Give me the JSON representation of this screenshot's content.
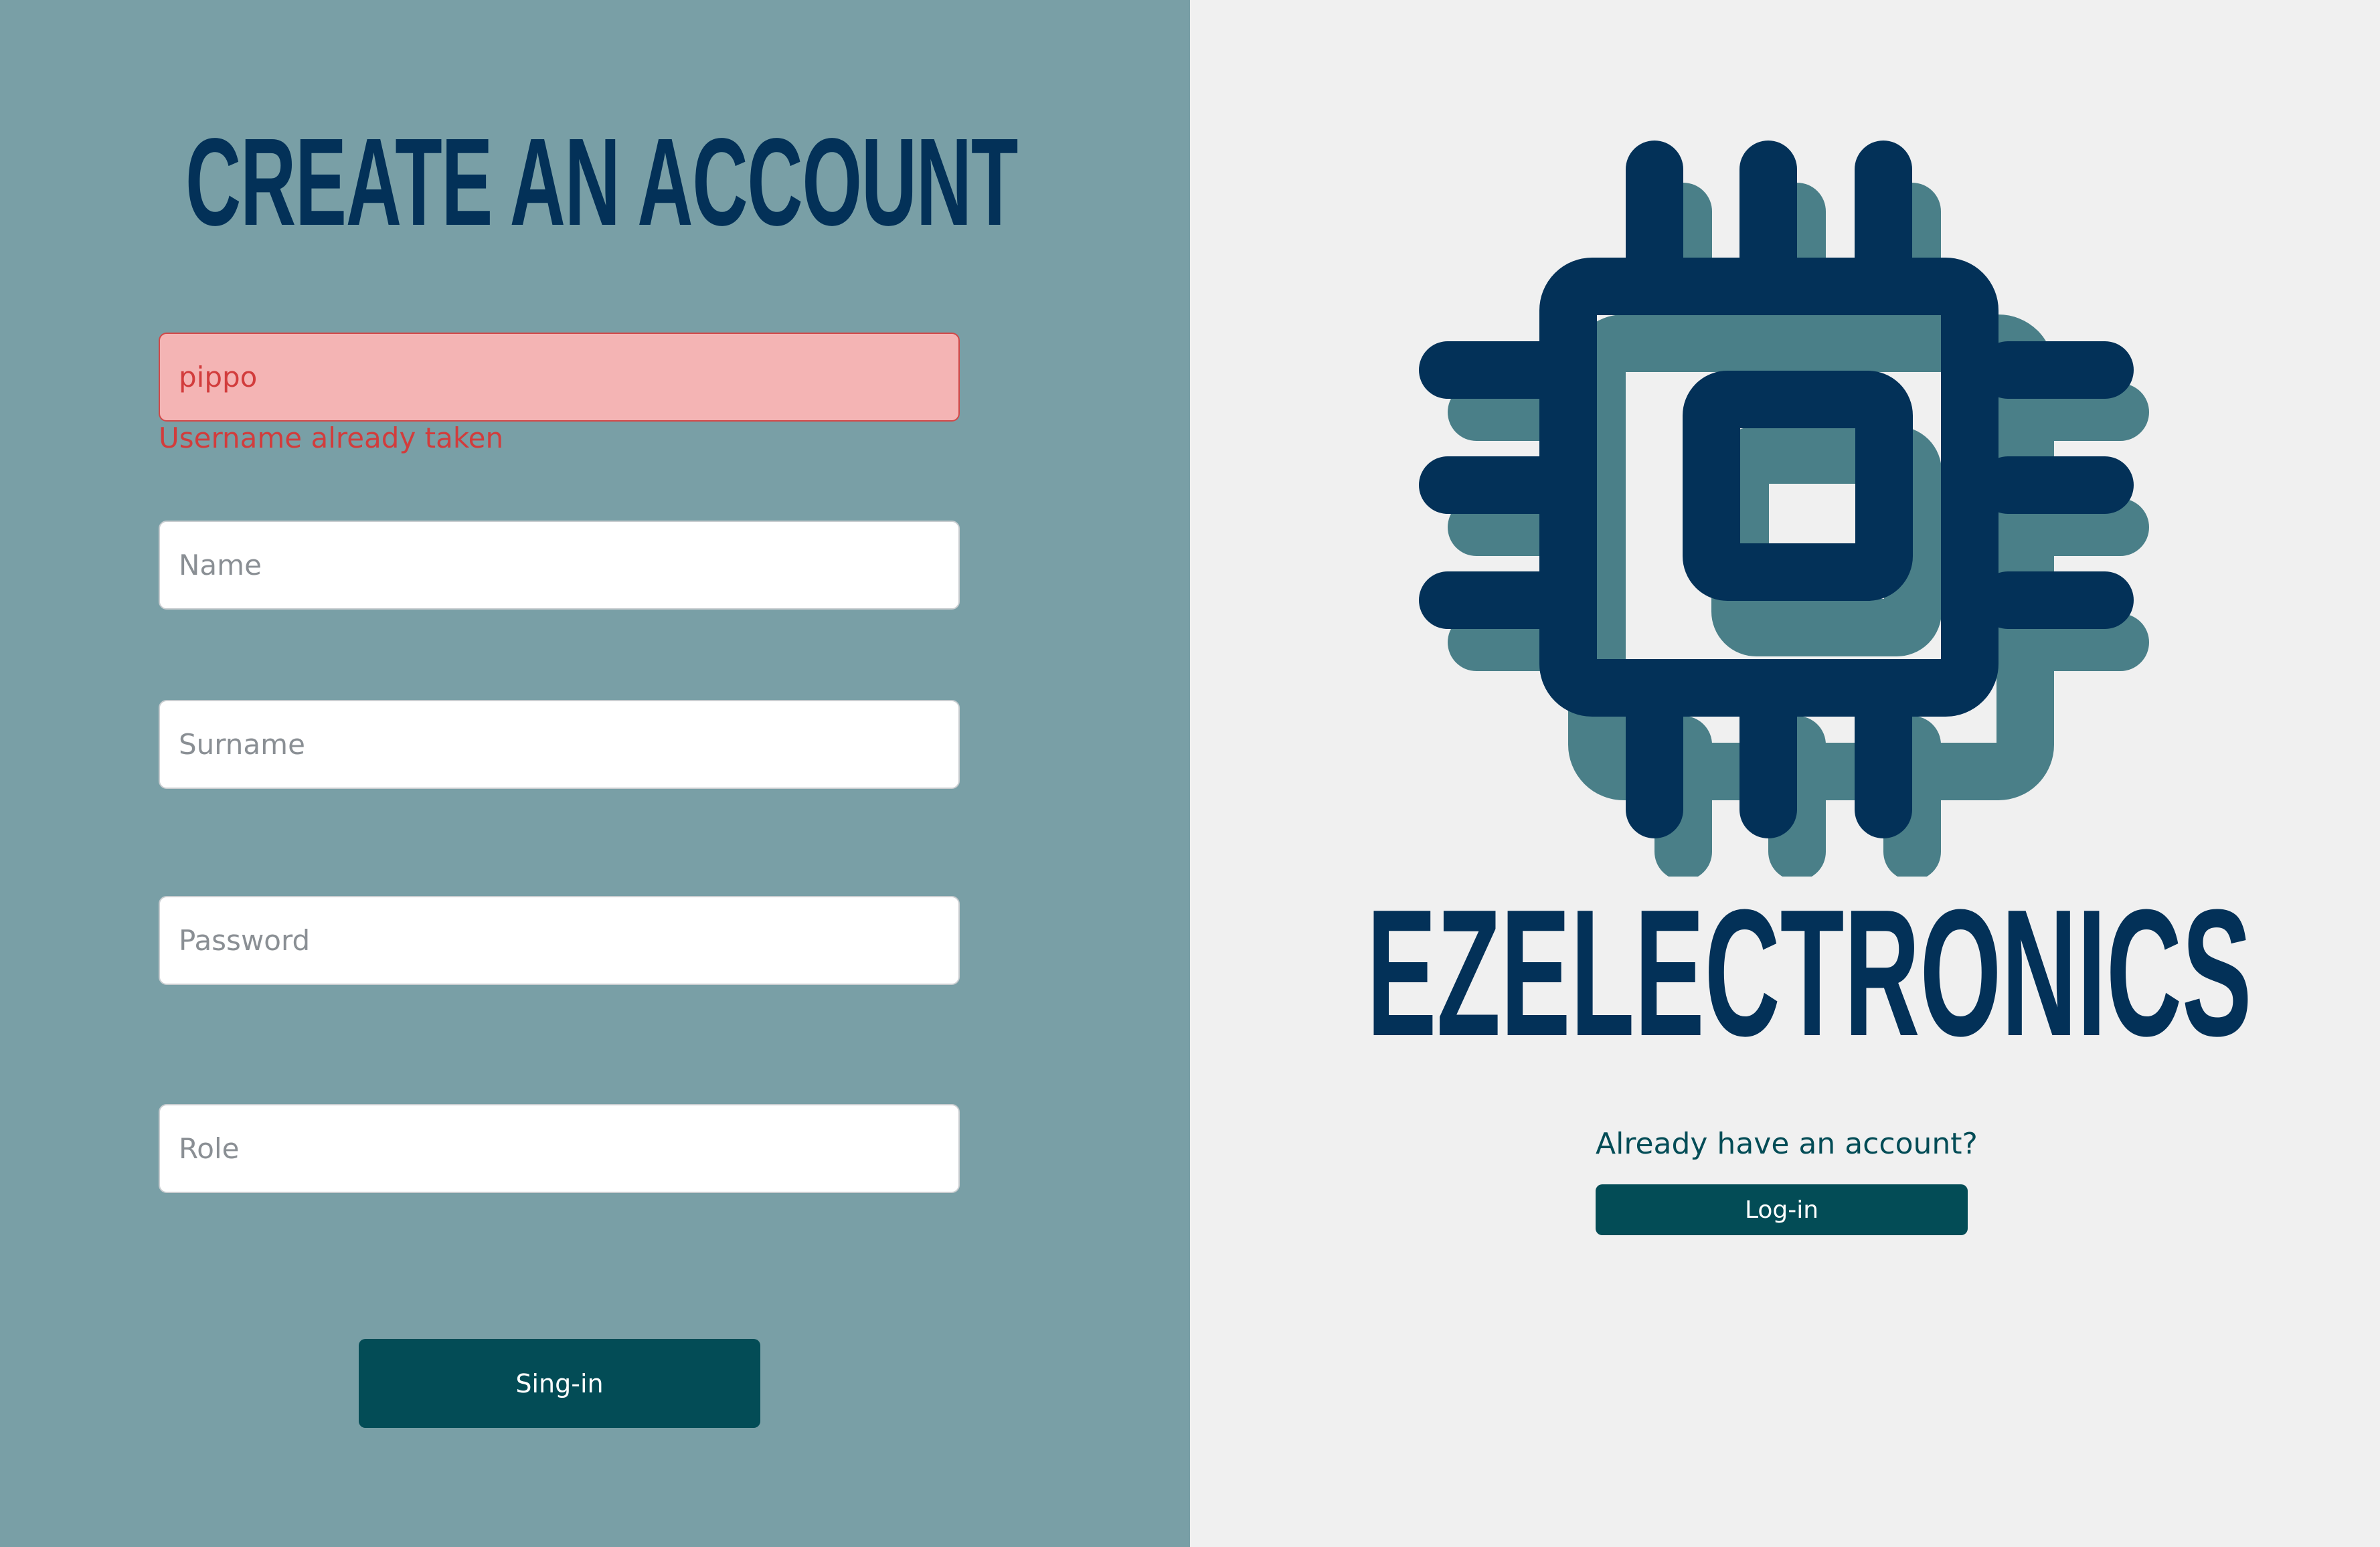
{
  "form": {
    "title": "Create an account",
    "username": {
      "value": "pippo",
      "error": "Username already taken"
    },
    "name": {
      "placeholder": "Name"
    },
    "surname": {
      "placeholder": "Surname"
    },
    "password": {
      "placeholder": "Password"
    },
    "role": {
      "placeholder": "Role"
    },
    "submit_label": "Sing-in"
  },
  "brand": {
    "name": "EZELECTRONICS",
    "logo_icon": "microchip-icon"
  },
  "login": {
    "prompt": "Already have an account?",
    "button_label": "Log-in"
  },
  "colors": {
    "left_panel": "#799fa6",
    "right_panel": "#f0f0f0",
    "navy": "#033158",
    "teal": "#034c56",
    "shadow_teal": "#4a7f88",
    "error": "#d23c3c",
    "error_bg": "#f4b4b4"
  }
}
